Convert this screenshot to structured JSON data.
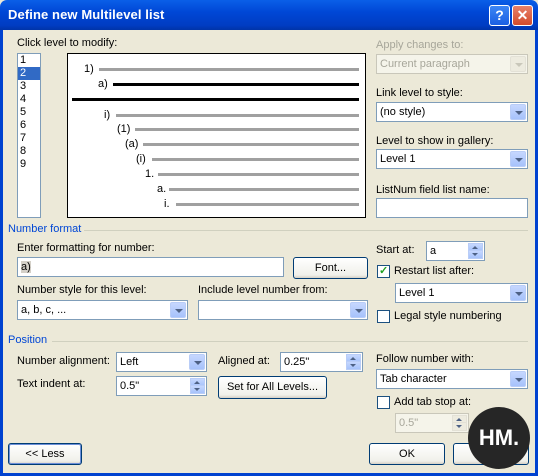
{
  "dialog": {
    "title": "Define new Multilevel list"
  },
  "level_picker": {
    "label": "Click level to modify:",
    "levels": [
      "1",
      "2",
      "3",
      "4",
      "5",
      "6",
      "7",
      "8",
      "9"
    ],
    "selected": "2"
  },
  "preview": {
    "labels": [
      "1)",
      "a)",
      "i)",
      "(1)",
      "(a)",
      "(i)",
      "1.",
      "a.",
      "i."
    ]
  },
  "apply_changes": {
    "label": "Apply changes to:",
    "value": "Current paragraph"
  },
  "link_level": {
    "label": "Link level to style:",
    "value": "(no style)"
  },
  "level_gallery": {
    "label": "Level to show in gallery:",
    "value": "Level 1"
  },
  "listnum": {
    "label": "ListNum field list name:",
    "value": ""
  },
  "number_format": {
    "section": "Number format",
    "formatting_label": "Enter formatting for number:",
    "formatting_value": "a)",
    "font_button": "Font...",
    "style_label": "Number style for this level:",
    "style_value": "a, b, c, ...",
    "include_label": "Include level number from:",
    "include_value": "",
    "start_at_label": "Start at:",
    "start_at_value": "a",
    "restart_label": "Restart list after:",
    "restart_value": "Level 1",
    "legal_label": "Legal style numbering"
  },
  "position": {
    "section": "Position",
    "alignment_label": "Number alignment:",
    "alignment_value": "Left",
    "aligned_at_label": "Aligned at:",
    "aligned_at_value": "0.25\"",
    "indent_label": "Text indent at:",
    "indent_value": "0.5\"",
    "set_all_button": "Set for All Levels...",
    "follow_label": "Follow number with:",
    "follow_value": "Tab character",
    "tab_stop_label": "Add tab stop at:",
    "tab_stop_value": "0.5\""
  },
  "footer": {
    "less_button": "<< Less",
    "ok_button": "OK",
    "watermark": "HM."
  }
}
